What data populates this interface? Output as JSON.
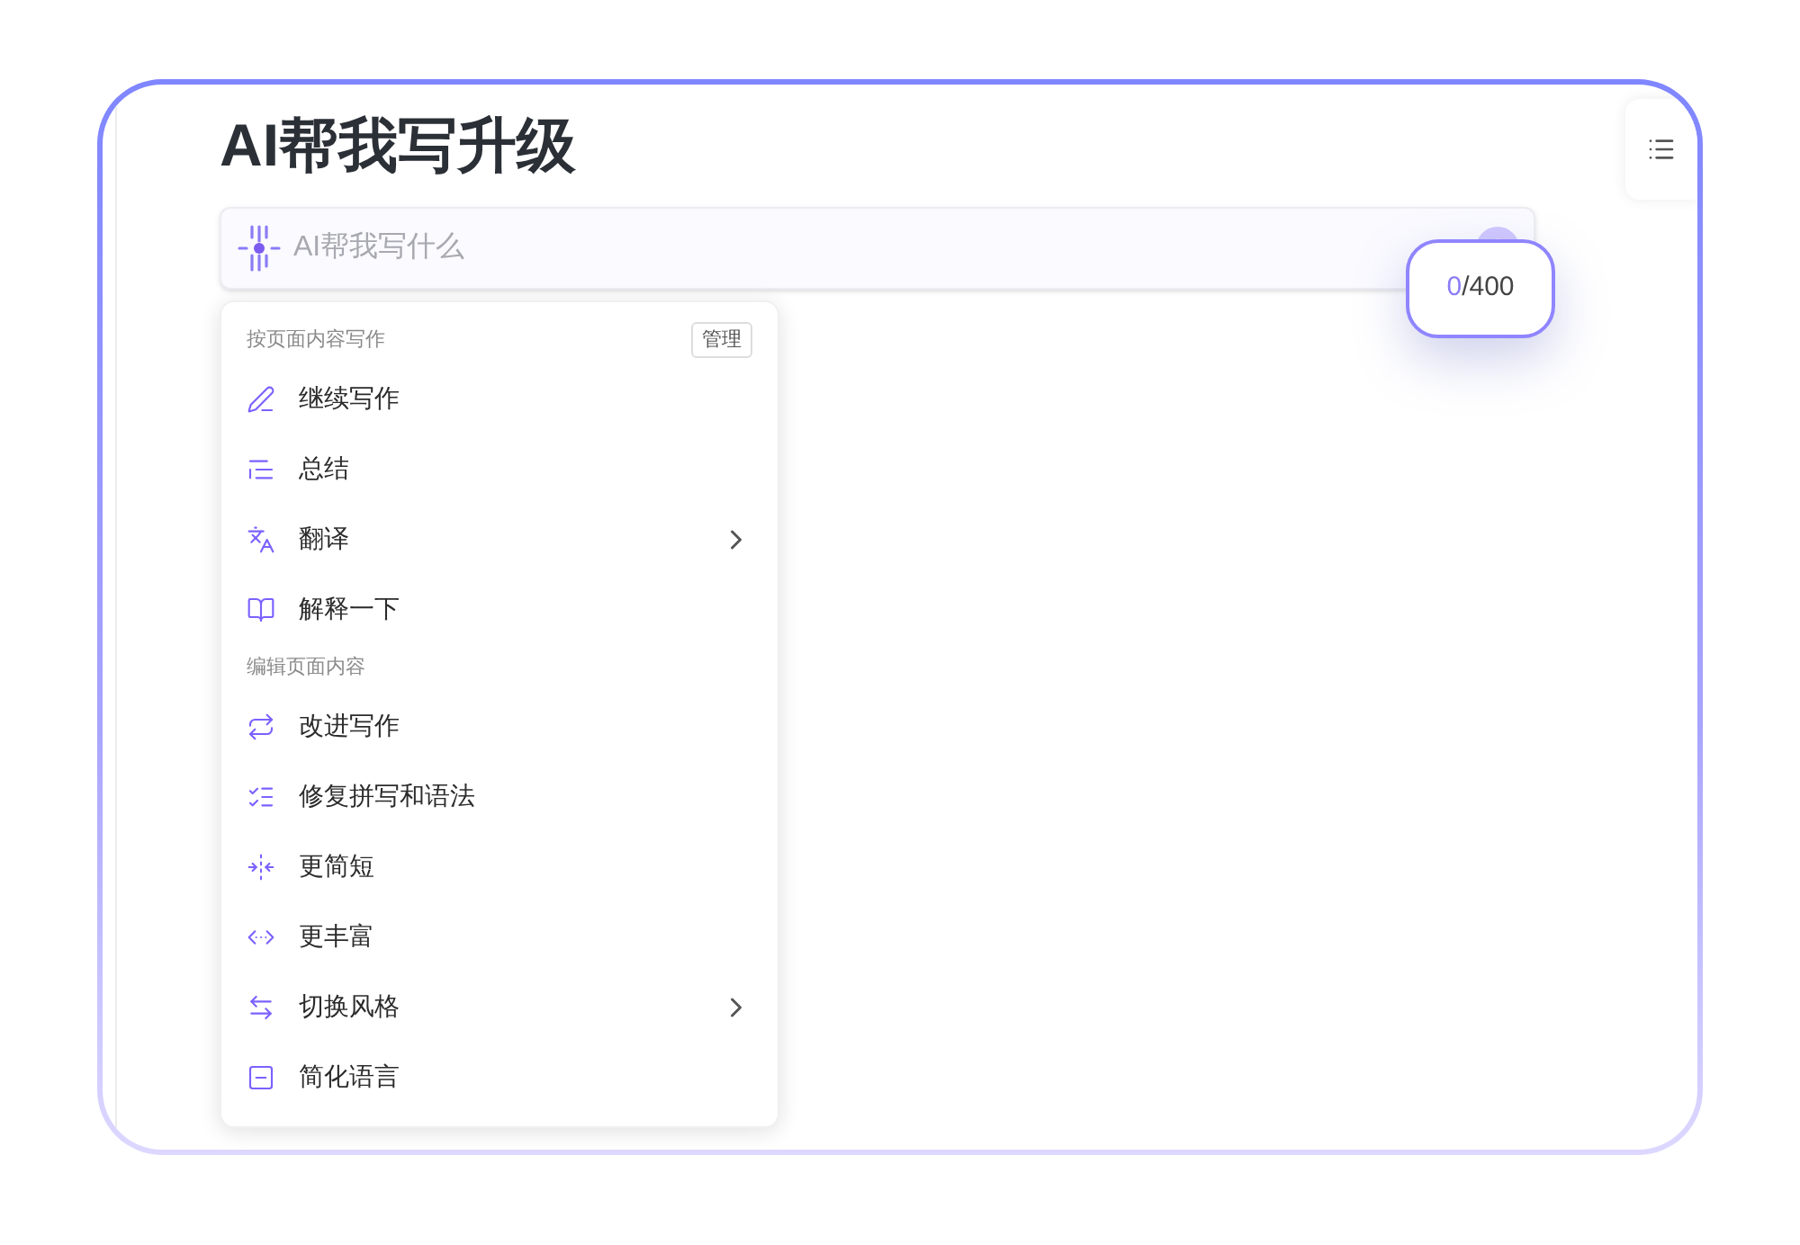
{
  "title": "AI帮我写升级",
  "prompt": {
    "placeholder": "AI帮我写什么"
  },
  "counter": {
    "current": "0",
    "limit": "/400"
  },
  "menu": [
    {
      "kind": "section",
      "label": "按页面内容写作",
      "action": "管理"
    },
    {
      "kind": "item",
      "label": "继续写作",
      "submenu": false
    },
    {
      "kind": "item",
      "label": "总结",
      "submenu": false
    },
    {
      "kind": "item",
      "label": "翻译",
      "submenu": true
    },
    {
      "kind": "item",
      "label": "解释一下",
      "submenu": false
    },
    {
      "kind": "section",
      "label": "编辑页面内容"
    },
    {
      "kind": "item",
      "label": "改进写作",
      "submenu": false
    },
    {
      "kind": "item",
      "label": "修复拼写和语法",
      "submenu": false
    },
    {
      "kind": "item",
      "label": "更简短",
      "submenu": false
    },
    {
      "kind": "item",
      "label": "更丰富",
      "submenu": false
    },
    {
      "kind": "item",
      "label": "切换风格",
      "submenu": true
    },
    {
      "kind": "item",
      "label": "简化语言",
      "submenu": false
    }
  ]
}
